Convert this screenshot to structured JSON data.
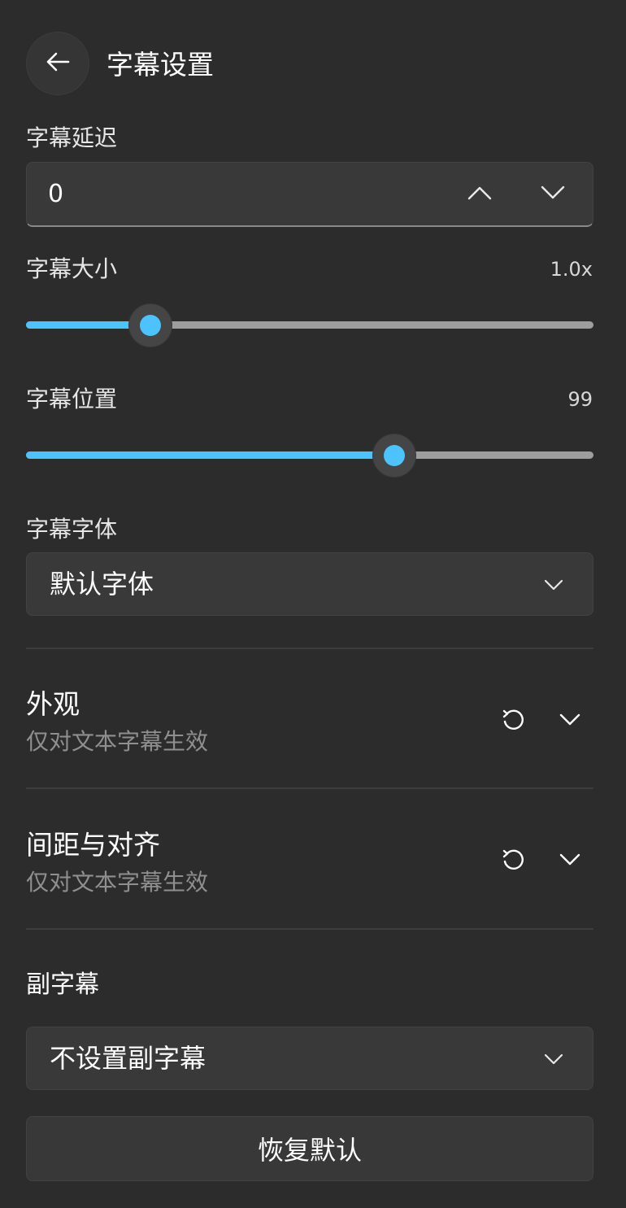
{
  "header": {
    "back_icon": "arrow-left-icon",
    "title": "字幕设置"
  },
  "subtitle_delay": {
    "label": "字幕延迟",
    "value": "0",
    "up_icon": "chevron-up-icon",
    "down_icon": "chevron-down-icon"
  },
  "subtitle_size": {
    "label": "字幕大小",
    "value_text": "1.0x",
    "slider_fraction": 0.219
  },
  "subtitle_position": {
    "label": "字幕位置",
    "value_text": "99",
    "slider_fraction": 0.649
  },
  "subtitle_font": {
    "label": "字幕字体",
    "selected": "默认字体",
    "dropdown_icon": "chevron-down-icon"
  },
  "appearance": {
    "title": "外观",
    "subtitle": "仅对文本字幕生效",
    "reset_icon": "undo-icon",
    "expand_icon": "chevron-down-icon"
  },
  "spacing_alignment": {
    "title": "间距与对齐",
    "subtitle": "仅对文本字幕生效",
    "reset_icon": "undo-icon",
    "expand_icon": "chevron-down-icon"
  },
  "secondary_subtitle": {
    "label": "副字幕",
    "selected": "不设置副字幕",
    "dropdown_icon": "chevron-down-icon"
  },
  "restore_defaults_label": "恢复默认",
  "colors": {
    "background": "#2c2c2c",
    "accent": "#4cc2ff",
    "track": "#9e9e9e",
    "control_bg": "#393939",
    "muted_text": "#8f8f8f"
  }
}
